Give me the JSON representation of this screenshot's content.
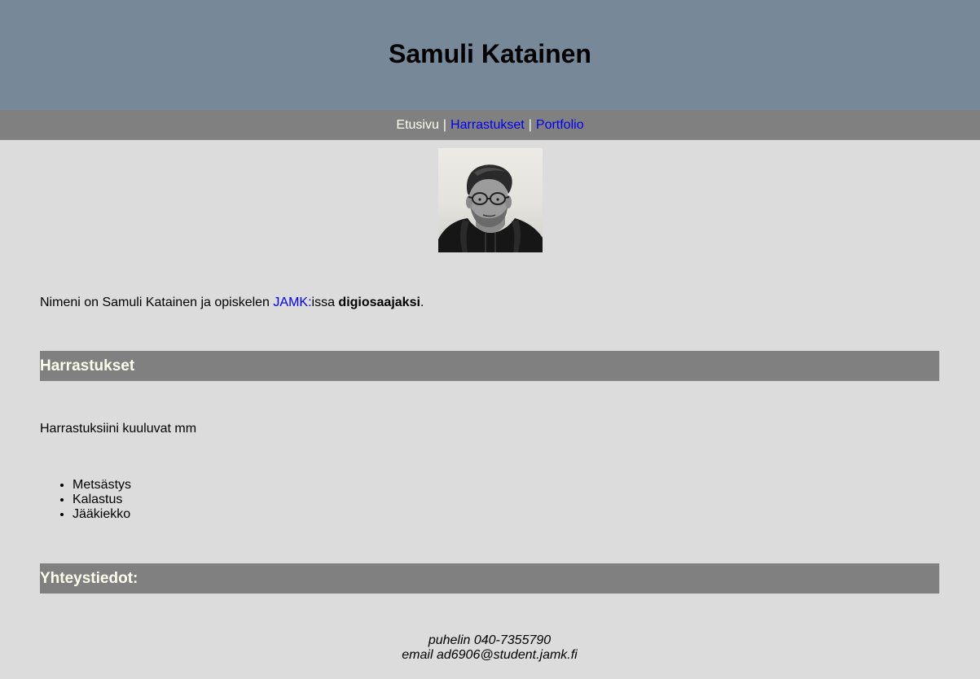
{
  "header": {
    "title": "Samuli Katainen"
  },
  "nav": {
    "items": [
      {
        "label": "Etusivu"
      },
      {
        "label": "Harrastukset"
      },
      {
        "label": "Portfolio"
      }
    ],
    "separator": "|"
  },
  "intro": {
    "text_before": "Nimeni on Samuli Katainen ja opiskelen ",
    "link": "JAMK:",
    "text_middle": "issa ",
    "bold": "digiosaajaksi",
    "text_after": "."
  },
  "hobbies": {
    "heading": "Harrastukset",
    "text": "Harrastuksiini kuuluvat mm",
    "items": [
      "Metsästys",
      "Kalastus",
      "Jääkiekko"
    ]
  },
  "contact": {
    "heading": "Yhteystiedot:",
    "phone": "puhelin 040-7355790",
    "email": "email ad6906@student.jamk.fi"
  },
  "colors": {
    "header_bg": "#778899",
    "nav_bg": "#808080",
    "page_bg": "#dcdcdc",
    "link": "#0000ee",
    "heading_text": "#fffff0"
  }
}
